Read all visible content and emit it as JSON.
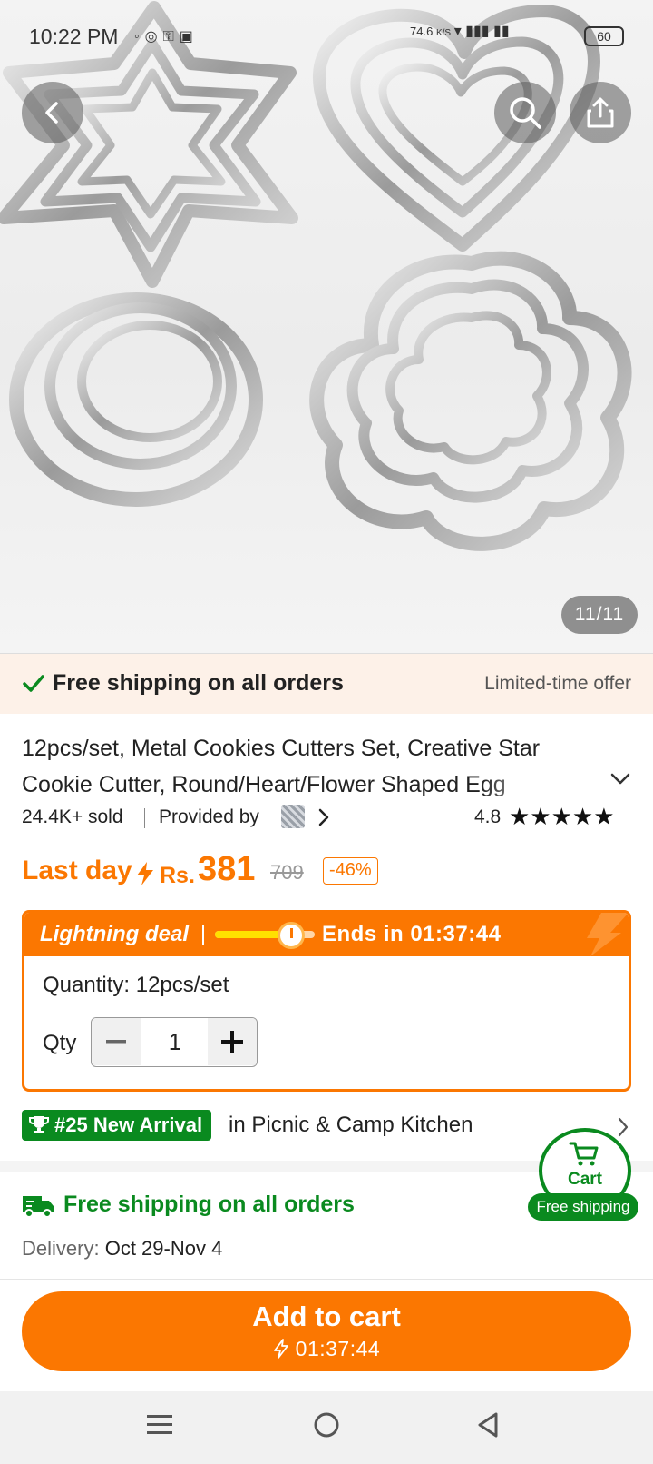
{
  "status_bar": {
    "time": "10:22 PM",
    "net_speed": "74.6",
    "net_unit": "K/S",
    "battery": "60"
  },
  "gallery": {
    "counter": "11/11"
  },
  "shipping_banner": {
    "text": "Free shipping on all orders",
    "limited": "Limited-time offer"
  },
  "product": {
    "title": "12pcs/set, Metal Cookies Cutters Set, Creative Star Cookie Cutter, Round/Heart/Flower Shaped Egg",
    "sold": "24.4K+ sold",
    "provided_by": "Provided by",
    "rating": "4.8",
    "stars": "★★★★★"
  },
  "price": {
    "last_day": "Last day",
    "currency": "Rs.",
    "current": "381",
    "original": "709",
    "discount": "-46%"
  },
  "deal": {
    "label": "Lightning deal",
    "progress": 0.8,
    "ends_in": "Ends in 01:37:44",
    "quantity_label": "Quantity: 12pcs/set",
    "qty_word": "Qty",
    "qty_value": "1"
  },
  "ranking": {
    "badge": "#25 New Arrival",
    "category": "in Picnic & Camp Kitchen"
  },
  "shipping": {
    "title": "Free shipping on all orders",
    "delivery_label": "Delivery:",
    "delivery_dates": "Oct 29-Nov 4"
  },
  "cart_float": {
    "label": "Cart",
    "badge": "Free shipping"
  },
  "add_to_cart": {
    "label": "Add to cart",
    "timer": "01:37:44"
  },
  "colors": {
    "accent": "#fb7701",
    "green": "#0a8a1f"
  }
}
